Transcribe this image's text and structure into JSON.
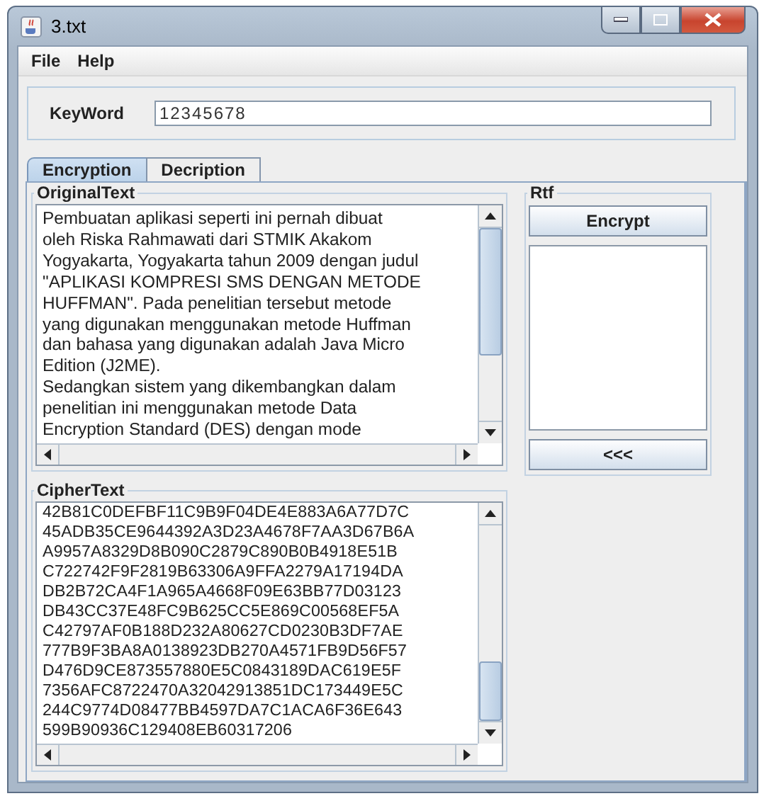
{
  "window": {
    "title": "3.txt"
  },
  "menu": [
    "File",
    "Help"
  ],
  "keyword": {
    "label": "KeyWord",
    "value": "12345678"
  },
  "tabs": [
    {
      "label": "Encryption",
      "selected": true
    },
    {
      "label": "Decription",
      "selected": false
    }
  ],
  "original_text": {
    "title": "OriginalText",
    "lines": [
      "Pembuatan aplikasi seperti ini pernah dibuat",
      "oleh Riska Rahmawati dari STMIK Akakom",
      "Yogyakarta, Yogyakarta tahun 2009 dengan judul",
      "\"APLIKASI KOMPRESI SMS DENGAN METODE",
      "HUFFMAN\". Pada penelitian tersebut metode",
      "yang digunakan menggunakan metode Huffman",
      "dan bahasa yang digunakan adalah Java Micro",
      "Edition (J2ME).",
      "Sedangkan sistem yang dikembangkan dalam",
      "penelitian ini menggunakan metode Data",
      "Encryption Standard (DES) dengan mode"
    ]
  },
  "rtf": {
    "title": "Rtf",
    "encrypt_button": "Encrypt",
    "back_button": "<<<"
  },
  "cipher_text": {
    "title": "CipherText",
    "lines": [
      "42B81C0DEFBF11C9B9F04DE4E883A6A77D7C",
      "45ADB35CE9644392A3D23A4678F7AA3D67B6A",
      "A9957A8329D8B090C2879C890B0B4918E51B",
      "C722742F9F2819B63306A9FFA2279A17194DA",
      "DB2B72CA4F1A965A4668F09E63BB77D03123",
      "DB43CC37E48FC9B625CC5E869C00568EF5A",
      "C42797AF0B188D232A80627CD0230B3DF7AE",
      "777B9F3BA8A0138923DB270A4571FB9D56F57",
      "D476D9CE873557880E5C0843189DAC619E5F",
      "7356AFC8722470A32042913851DC173449E5C",
      "244C9774D08477BB4597DA7C1ACA6F36E643",
      "599B90936C129408EB60317206"
    ]
  }
}
